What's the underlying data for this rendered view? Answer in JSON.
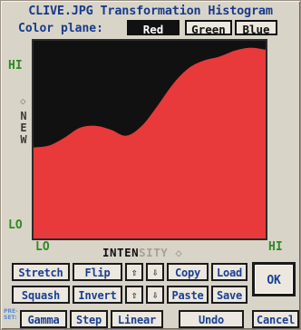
{
  "window": {
    "title": "CLIVE.JPG Transformation Histogram"
  },
  "color_plane": {
    "label": "Color plane:",
    "options": [
      "Red",
      "Green",
      "Blue"
    ],
    "selected": "Red"
  },
  "axes": {
    "y_hi": "HI",
    "y_lo": "LO",
    "y_label_letters": [
      "N",
      "E",
      "W"
    ],
    "x_lo": "LO",
    "x_hi": "HI",
    "x_label_dark": "INTEN",
    "x_label_light": "SITY"
  },
  "curve": {
    "color": "#e83a3a",
    "background": "#111111",
    "levels": [
      0.46,
      0.47,
      0.51,
      0.56,
      0.57,
      0.55,
      0.52,
      0.57,
      0.67,
      0.78,
      0.86,
      0.9,
      0.92,
      0.95,
      0.965,
      0.955
    ]
  },
  "buttons": {
    "stretch": "Stretch",
    "flip": "Flip",
    "copy": "Copy",
    "load": "Load",
    "ok": "OK",
    "squash": "Squash",
    "invert": "Invert",
    "paste": "Paste",
    "save": "Save",
    "preset_label": "PRE-SET:",
    "gamma": "Gamma",
    "step": "Step",
    "linear": "Linear",
    "undo": "Undo",
    "cancel": "Cancel"
  },
  "icons": {
    "up_arrow": "up-arrow-icon",
    "down_arrow": "down-arrow-icon"
  }
}
